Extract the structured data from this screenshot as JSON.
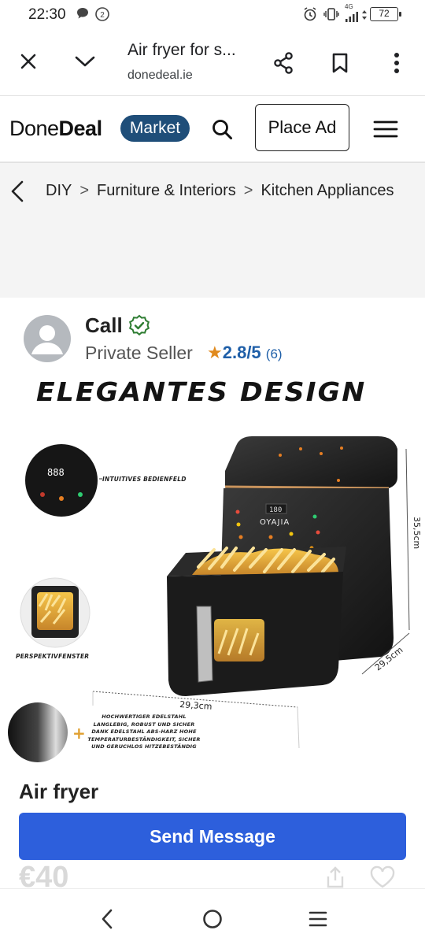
{
  "status_bar": {
    "time": "22:30",
    "network": "4G",
    "battery": "72"
  },
  "browser": {
    "title": "Air fryer for s...",
    "url": "donedeal.ie"
  },
  "site_header": {
    "logo_regular": "Done",
    "logo_bold": "Deal",
    "market_badge": "Market",
    "place_ad_label": "Place Ad"
  },
  "breadcrumbs": {
    "items": [
      "DIY",
      "Furniture & Interiors",
      "Kitchen Appliances"
    ],
    "separator": ">"
  },
  "seller": {
    "name": "Call",
    "type": "Private Seller",
    "rating": "2.8/5",
    "rating_count": "(6)"
  },
  "product_image": {
    "headline": "ELEGANTES DESIGN",
    "display_digits": "888",
    "fryer_display": "180",
    "brand": "OYAJIA",
    "caption_panel": "INTUITIVES BEDIENFELD",
    "caption_window": "PERSPEKTIVFENSTER",
    "caption_steel": "HOCHWERTIGER EDELSTAHL LANGLEBIG, ROBUST UND SICHER DANK EDELSTAHL ABS-HARZ HOHE TEMPERATURBESTÄNDIGKEIT, SICHER UND GERUCHLOS HITZEBESTÄNDIG",
    "dim_height": "35,5cm",
    "dim_depth": "29,5cm",
    "dim_width": "29,3cm"
  },
  "listing": {
    "title": "Air fryer",
    "send_message_label": "Send Message",
    "price": "€40"
  },
  "colors": {
    "brand_blue": "#2d5fdc",
    "market_badge": "#1f4e79",
    "verified_green": "#2e7d32",
    "star": "#e08a1e"
  }
}
